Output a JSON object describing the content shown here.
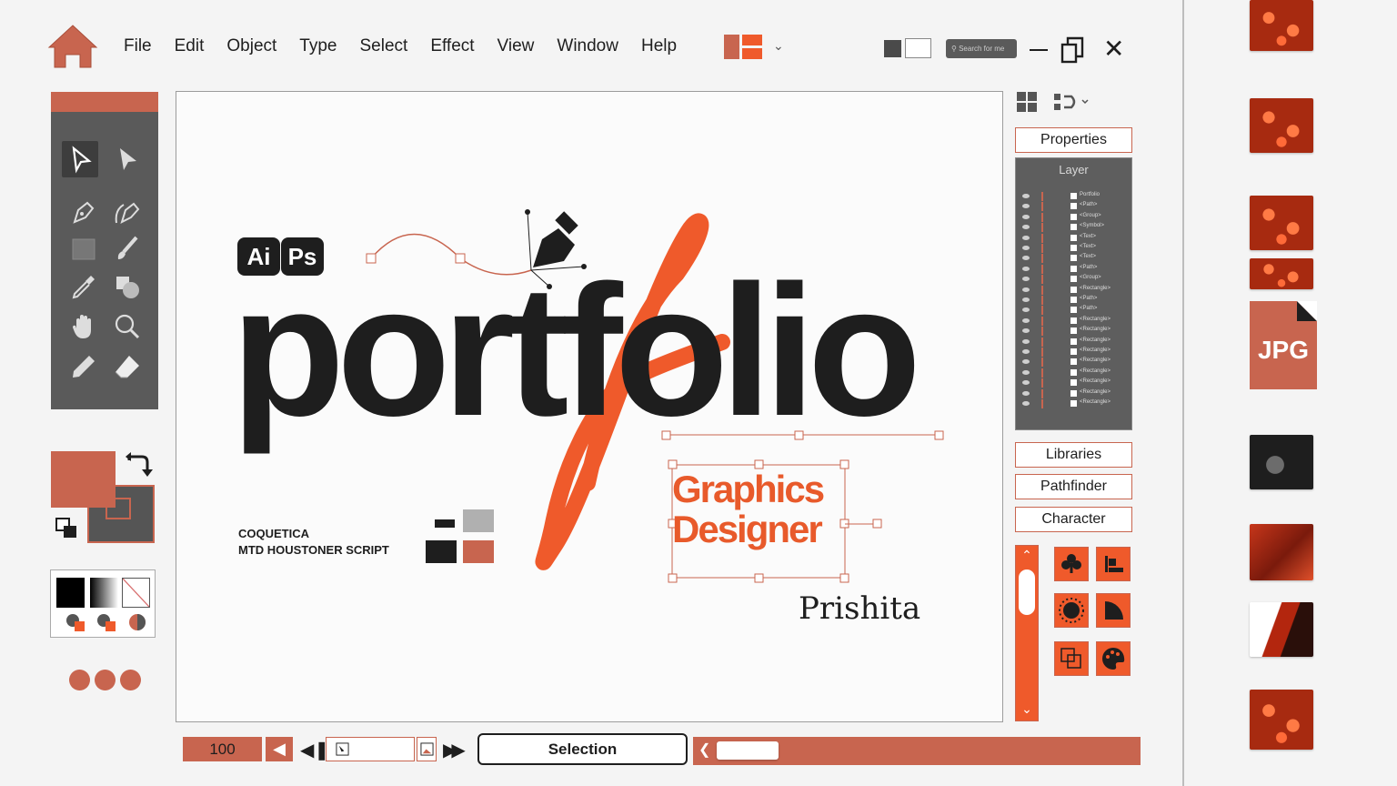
{
  "menu": {
    "items": [
      "File",
      "Edit",
      "Object",
      "Type",
      "Select",
      "Effect",
      "View",
      "Window",
      "Help"
    ]
  },
  "header": {
    "search_placeholder": "Search for me"
  },
  "artwork": {
    "app_badges": [
      "Ai",
      "Ps"
    ],
    "headline": "portfolio",
    "font_notes": [
      "COQUETICA",
      "MTD HOUSTONER SCRIPT"
    ],
    "role_line1": "Graphics",
    "role_line2": "Designer",
    "name": "Prishita"
  },
  "right_panel": {
    "properties_label": "Properties",
    "layer_title": "Layer",
    "libraries_label": "Libraries",
    "pathfinder_label": "Pathfinder",
    "character_label": "Character"
  },
  "layers": [
    "Portfolio",
    "<Path>",
    "<Group>",
    "<Symbol>",
    "<Text>",
    "<Text>",
    "<Text>",
    "<Path>",
    "<Group>",
    "<Rectangle>",
    "<Path>",
    "<Path>",
    "<Rectangle>",
    "<Rectangle>",
    "<Rectangle>",
    "<Rectangle>",
    "<Rectangle>",
    "<Rectangle>",
    "<Rectangle>",
    "<Rectangle>",
    "<Rectangle>"
  ],
  "status_bar": {
    "zoom": "100",
    "mode": "Selection"
  },
  "files": {
    "jpg_label": "JPG"
  },
  "colors": {
    "accent": "#c8654f",
    "orange": "#ef5a2b",
    "dark": "#1e1e1e",
    "panel": "#5a5a5a"
  },
  "icons": [
    "home-icon",
    "selection-tool-icon",
    "direct-selection-tool-icon",
    "pen-tool-icon",
    "curvature-tool-icon",
    "rectangle-tool-icon",
    "brush-tool-icon",
    "eyedropper-tool-icon",
    "shape-builder-tool-icon",
    "hand-tool-icon",
    "zoom-tool-icon",
    "pencil-tool-icon",
    "eraser-tool-icon",
    "swap-colors-icon",
    "grid-view-icon",
    "arrange-icon",
    "club-icon",
    "align-icon",
    "sun-icon",
    "quarter-circle-icon",
    "overlap-icon",
    "palette-icon"
  ]
}
